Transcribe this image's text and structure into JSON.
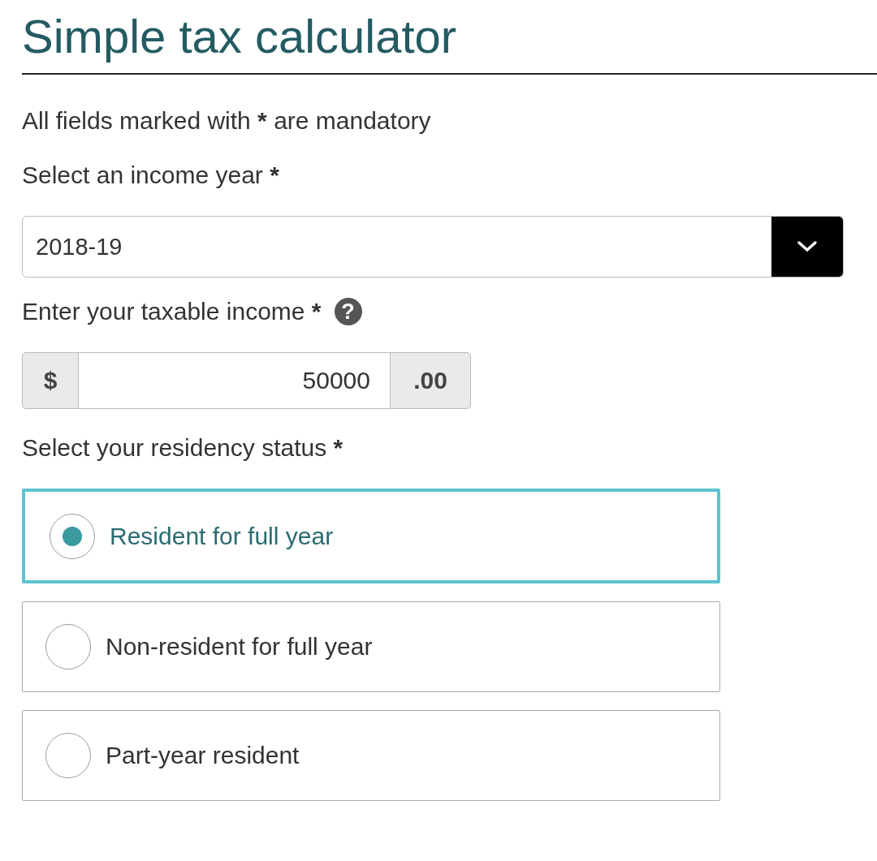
{
  "title": "Simple tax calculator",
  "intro": {
    "before": "All fields marked with",
    "mark": "*",
    "after": "are mandatory"
  },
  "income_year": {
    "label": "Select an income year",
    "required_mark": "*",
    "value": "2018-19"
  },
  "taxable_income": {
    "label": "Enter your taxable income",
    "required_mark": "*",
    "help": "?",
    "prefix": "$",
    "value": "50000",
    "suffix": ".00"
  },
  "residency": {
    "label": "Select your residency status",
    "required_mark": "*",
    "options": [
      {
        "label": "Resident for full year",
        "selected": true
      },
      {
        "label": "Non-resident for full year",
        "selected": false
      },
      {
        "label": "Part-year resident",
        "selected": false
      }
    ]
  }
}
